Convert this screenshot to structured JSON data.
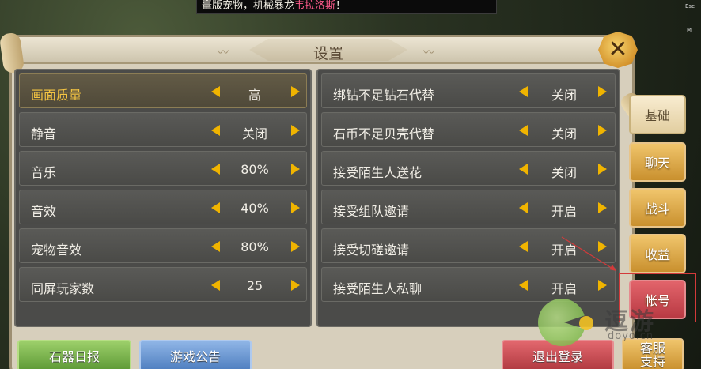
{
  "notice": {
    "text_prefix": "鼍版宠物，机械暴龙",
    "text_highlight": "韦拉洛斯",
    "text_suffix": "！"
  },
  "hotkeys": {
    "esc": "Esc",
    "m": "M"
  },
  "panel": {
    "title": "设置"
  },
  "left_settings": [
    {
      "label": "画面质量",
      "value": "高",
      "active": true
    },
    {
      "label": "静音",
      "value": "关闭",
      "active": false
    },
    {
      "label": "音乐",
      "value": "80%",
      "active": false
    },
    {
      "label": "音效",
      "value": "40%",
      "active": false
    },
    {
      "label": "宠物音效",
      "value": "80%",
      "active": false
    },
    {
      "label": "同屏玩家数",
      "value": "25",
      "active": false
    }
  ],
  "right_settings": [
    {
      "label": "绑钻不足钻石代替",
      "value": "关闭"
    },
    {
      "label": "石币不足贝壳代替",
      "value": "关闭"
    },
    {
      "label": "接受陌生人送花",
      "value": "关闭"
    },
    {
      "label": "接受组队邀请",
      "value": "开启"
    },
    {
      "label": "接受切磋邀请",
      "value": "开启"
    },
    {
      "label": "接受陌生人私聊",
      "value": "开启"
    }
  ],
  "tabs": [
    {
      "label": "基础",
      "style": "base"
    },
    {
      "label": "聊天",
      "style": "gold"
    },
    {
      "label": "战斗",
      "style": "gold"
    },
    {
      "label": "收益",
      "style": "gold"
    },
    {
      "label": "帐号",
      "style": "red"
    }
  ],
  "buttons": {
    "daily_report": "石器日报",
    "announcement": "游戏公告",
    "logout": "退出登录",
    "support_line1": "客服",
    "support_line2": "支持"
  },
  "watermark": {
    "text": "逗游",
    "domain": "doyo.cn"
  },
  "colors": {
    "accent": "#f0b400",
    "active_label": "#f5c542",
    "highlight": "#ff5b8c"
  }
}
